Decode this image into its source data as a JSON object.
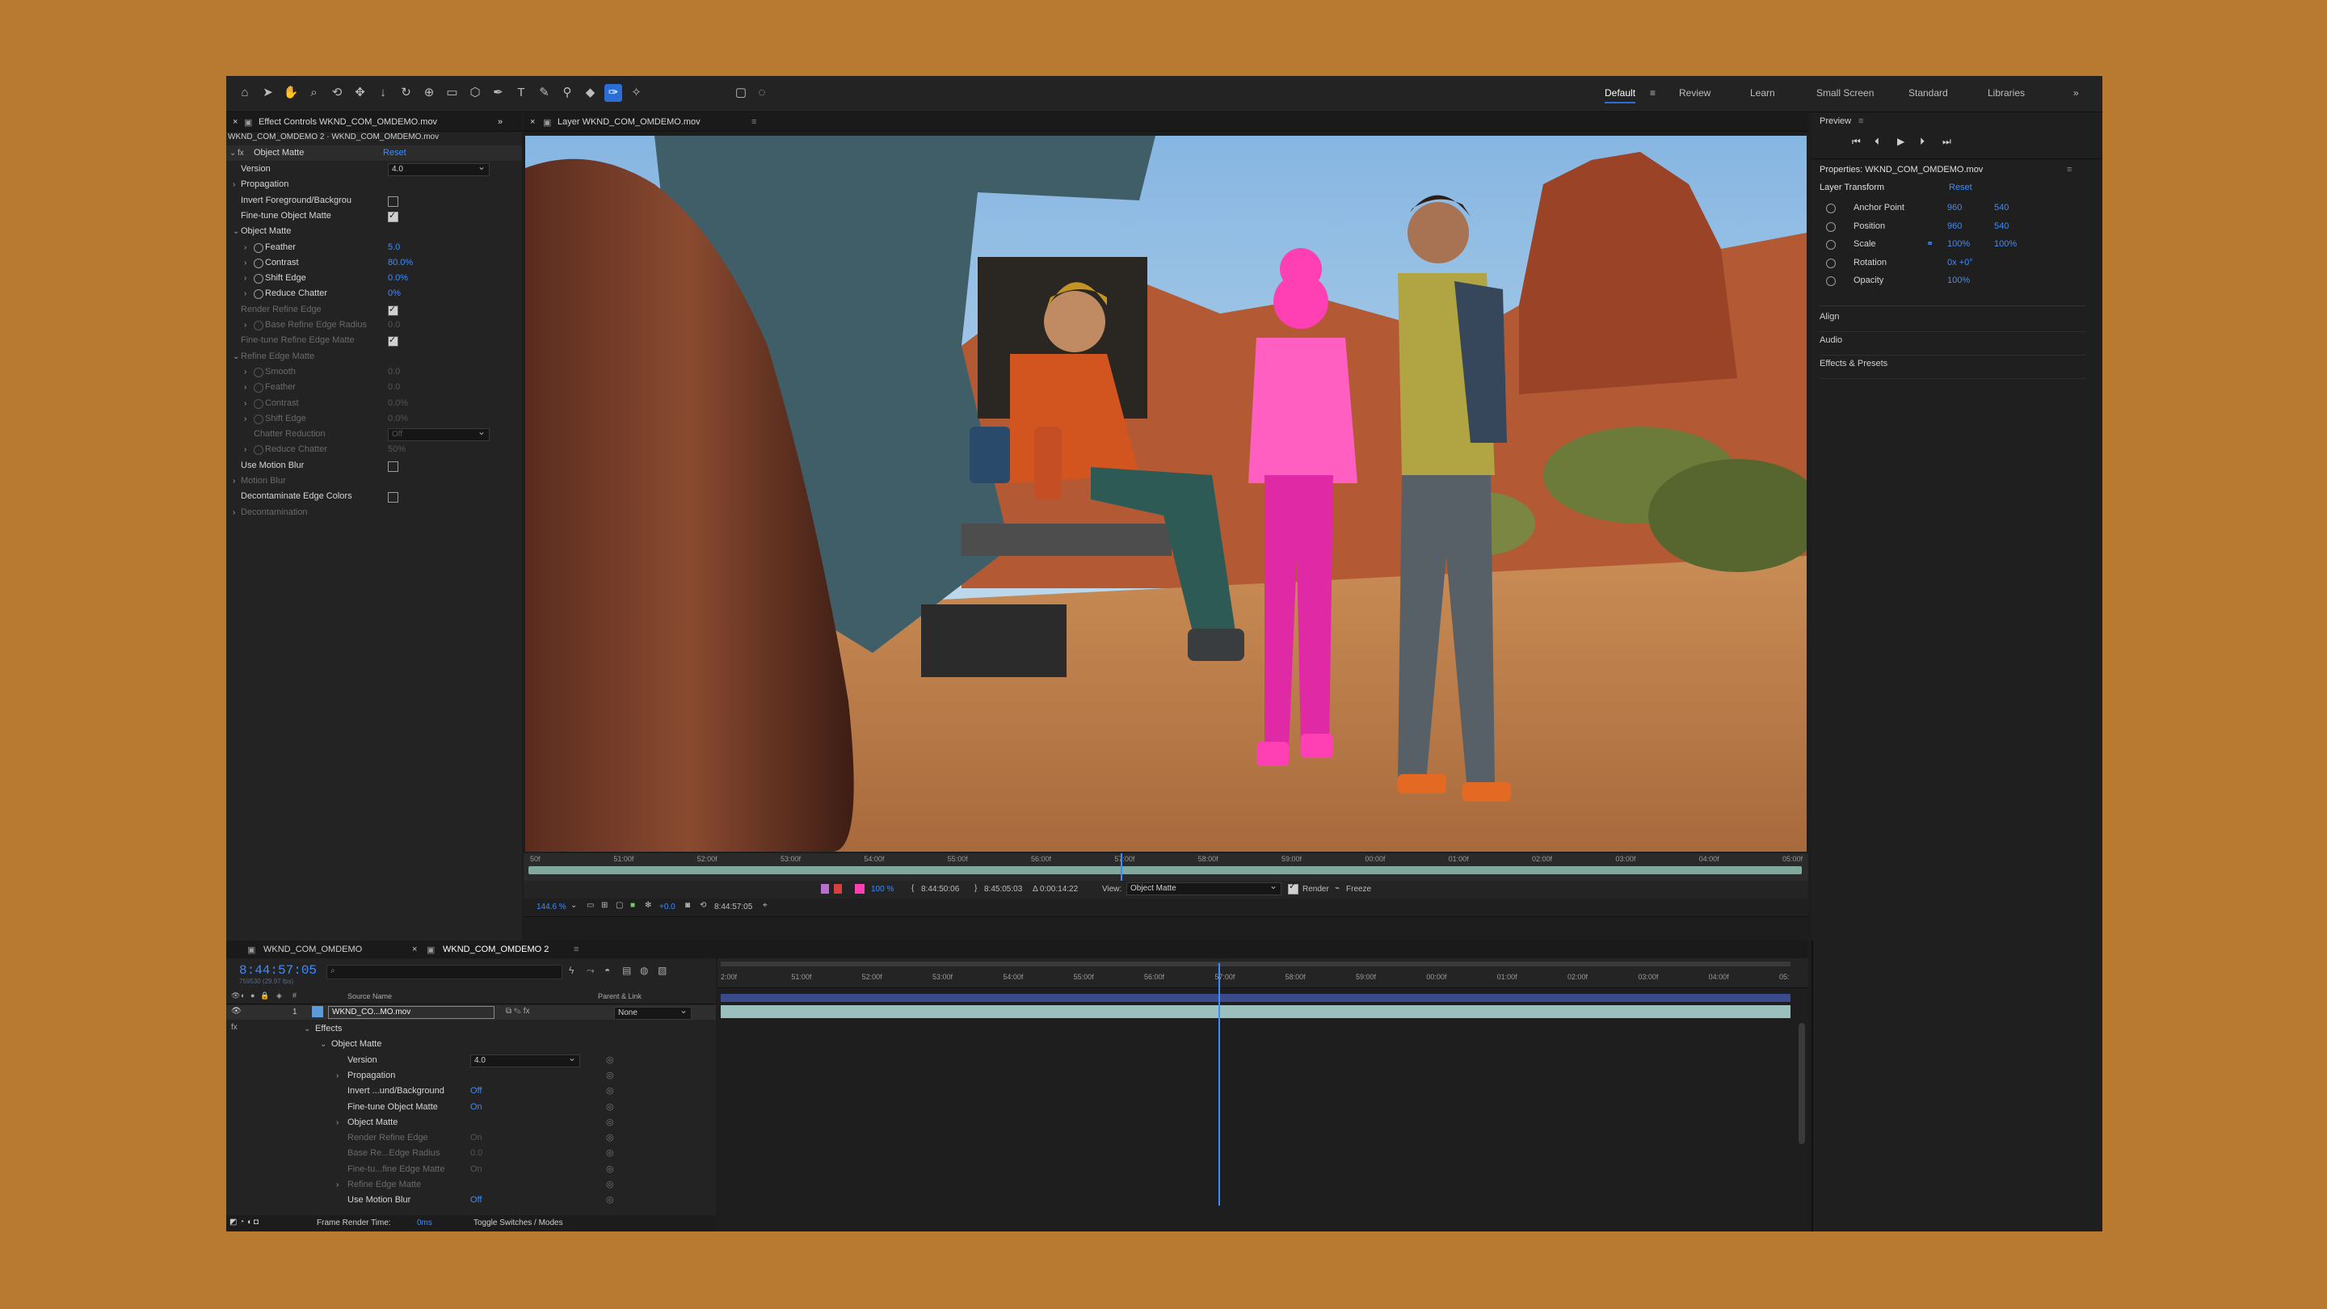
{
  "toolbar": {
    "workspaces": [
      "Default",
      "Review",
      "Learn",
      "Small Screen",
      "Standard",
      "Libraries"
    ],
    "active_workspace": "Default",
    "tools": [
      "home-icon",
      "selection-icon",
      "hand-icon",
      "zoom-icon",
      "orbit-icon",
      "pan-icon",
      "dolly-icon",
      "rotate-icon",
      "anchor-icon",
      "rectangle-icon",
      "cube-icon",
      "pen-icon",
      "type-icon",
      "brush-icon",
      "clone-stamp-icon",
      "eraser-icon",
      "roto-brush-icon",
      "puppet-pin-icon"
    ],
    "overflow": "»"
  },
  "effect_controls": {
    "tab_label": "Effect Controls WKND_COM_OMDEMO.mov",
    "subtitle": "WKND_COM_OMDEMO 2 · WKND_COM_OMDEMO.mov",
    "effect_name": "Object Matte",
    "reset": "Reset",
    "rows": [
      {
        "label": "Version",
        "value": "4.0",
        "type": "dropdown",
        "indent": 1,
        "dim": false
      },
      {
        "label": "Propagation",
        "type": "group",
        "indent": 1,
        "dim": false
      },
      {
        "label": "Invert Foreground/Backgrou",
        "type": "checkbox",
        "checked": false,
        "indent": 1,
        "dim": false
      },
      {
        "label": "Fine-tune Object Matte",
        "type": "checkbox",
        "checked": true,
        "indent": 1,
        "dim": false
      },
      {
        "label": "Object Matte",
        "type": "group-open",
        "indent": 1,
        "dim": false
      },
      {
        "label": "Feather",
        "value": "5.0",
        "type": "prop",
        "indent": 2,
        "dim": false
      },
      {
        "label": "Contrast",
        "value": "80.0%",
        "type": "prop",
        "indent": 2,
        "dim": false
      },
      {
        "label": "Shift Edge",
        "value": "0.0%",
        "type": "prop",
        "indent": 2,
        "dim": false
      },
      {
        "label": "Reduce Chatter",
        "value": "0%",
        "type": "prop",
        "indent": 2,
        "dim": false
      },
      {
        "label": "Render Refine Edge",
        "type": "checkbox",
        "checked": true,
        "indent": 1,
        "dim": true
      },
      {
        "label": "Base Refine Edge Radius",
        "value": "0.0",
        "type": "prop",
        "indent": 2,
        "dim": true
      },
      {
        "label": "Fine-tune Refine Edge Matte",
        "type": "checkbox",
        "checked": true,
        "indent": 1,
        "dim": true
      },
      {
        "label": "Refine Edge Matte",
        "type": "group-open",
        "indent": 1,
        "dim": true
      },
      {
        "label": "Smooth",
        "value": "0.0",
        "type": "prop",
        "indent": 2,
        "dim": true
      },
      {
        "label": "Feather",
        "value": "0.0",
        "type": "prop",
        "indent": 2,
        "dim": true
      },
      {
        "label": "Contrast",
        "value": "0.0%",
        "type": "prop",
        "indent": 2,
        "dim": true
      },
      {
        "label": "Shift Edge",
        "value": "0.0%",
        "type": "prop",
        "indent": 2,
        "dim": true
      },
      {
        "label": "Chatter Reduction",
        "value": "Off",
        "type": "dropdown",
        "indent": 2,
        "dim": true
      },
      {
        "label": "Reduce Chatter",
        "value": "50%",
        "type": "prop",
        "indent": 2,
        "dim": true
      },
      {
        "label": "Use Motion Blur",
        "type": "checkbox",
        "checked": false,
        "indent": 1,
        "dim": false
      },
      {
        "label": "Motion Blur",
        "type": "group",
        "indent": 1,
        "dim": true
      },
      {
        "label": "Decontaminate Edge Colors",
        "type": "checkbox",
        "checked": false,
        "indent": 1,
        "dim": false
      },
      {
        "label": "Decontamination",
        "type": "group",
        "indent": 1,
        "dim": true
      }
    ]
  },
  "viewer": {
    "tab_label": "Layer WKND_COM_OMDEMO.mov",
    "ruler_ticks": [
      "50f",
      "51:00f",
      "52:00f",
      "53:00f",
      "54:00f",
      "55:00f",
      "56:00f",
      "57:00f",
      "58:00f",
      "59:00f",
      "00:00f",
      "01:00f",
      "02:00f",
      "03:00f",
      "04:00f",
      "05:00f"
    ],
    "in_time": "8:44:50:06",
    "out_time": "8:45:05:03",
    "duration": "Δ 0:00:14:22",
    "view_label": "View:",
    "view_value": "Object Matte",
    "render_label": "Render",
    "freeze_label": "Freeze",
    "zoom": "144.6 %",
    "exposure": "+0.0",
    "current_time": "8:44:57:05",
    "opacity_value": "100 %",
    "playhead_fraction": 0.465
  },
  "timeline": {
    "tabs": [
      "WKND_COM_OMDEMO",
      "WKND_COM_OMDEMO 2"
    ],
    "timecode": "8:44:57:05",
    "timecode_sub": "759530 (29.97 fps)",
    "search_placeholder": "",
    "col_source": "Source Name",
    "col_parent": "Parent & Link",
    "layer_name": "WKND_CO...MO.mov",
    "layer_num": "1",
    "parent_value": "None",
    "ticks": [
      "2:00f",
      "51:00f",
      "52:00f",
      "53:00f",
      "54:00f",
      "55:00f",
      "56:00f",
      "57:00f",
      "58:00f",
      "59:00f",
      "00:00f",
      "01:00f",
      "02:00f",
      "03:00f",
      "04:00f",
      "05:"
    ],
    "playhead_fraction": 0.465,
    "props": [
      {
        "label": "Effects",
        "value": "",
        "indent": 0,
        "dim": false
      },
      {
        "label": "Object Matte",
        "value": "",
        "indent": 1,
        "dim": false
      },
      {
        "label": "Version",
        "value": "4.0",
        "indent": 2,
        "dim": false,
        "dropdown": true
      },
      {
        "label": "Propagation",
        "value": "",
        "indent": 2,
        "dim": false,
        "caret": true
      },
      {
        "label": "Invert ...und/Background",
        "value": "Off",
        "indent": 2,
        "dim": false
      },
      {
        "label": "Fine-tune Object Matte",
        "value": "On",
        "indent": 2,
        "dim": false
      },
      {
        "label": "Object Matte",
        "value": "",
        "indent": 2,
        "dim": false,
        "caret": true
      },
      {
        "label": "Render Refine Edge",
        "value": "On",
        "indent": 2,
        "dim": true
      },
      {
        "label": "Base Re...Edge Radius",
        "value": "0.0",
        "indent": 2,
        "dim": true
      },
      {
        "label": "Fine-tu...fine Edge Matte",
        "value": "On",
        "indent": 2,
        "dim": true
      },
      {
        "label": "Refine Edge Matte",
        "value": "",
        "indent": 2,
        "dim": true,
        "caret": true
      },
      {
        "label": "Use Motion Blur",
        "value": "Off",
        "indent": 2,
        "dim": false
      }
    ],
    "footer_render": "Frame Render Time:",
    "footer_render_value": "0ms",
    "footer_toggle": "Toggle Switches / Modes"
  },
  "preview": {
    "title": "Preview",
    "controls": [
      "first-frame-icon",
      "prev-frame-icon",
      "play-icon",
      "next-frame-icon",
      "last-frame-icon"
    ]
  },
  "properties": {
    "title": "Properties: WKND_COM_OMDEMO.mov",
    "section": "Layer Transform",
    "reset": "Reset",
    "rows": [
      {
        "label": "Anchor Point",
        "v1": "960",
        "v2": "540"
      },
      {
        "label": "Position",
        "v1": "960",
        "v2": "540"
      },
      {
        "label": "Scale",
        "v1": "100%",
        "v2": "100%"
      },
      {
        "label": "Rotation",
        "v1": "0x +0°",
        "v2": ""
      },
      {
        "label": "Opacity",
        "v1": "100%",
        "v2": ""
      }
    ],
    "panels": [
      "Align",
      "Audio",
      "Effects & Presets"
    ]
  },
  "colors": {
    "background": "#b87a31",
    "accent": "#2b6fd6",
    "value_blue": "#3d8cff",
    "matte_pink": "#ff3fb4",
    "sky": "#8fb9df"
  }
}
